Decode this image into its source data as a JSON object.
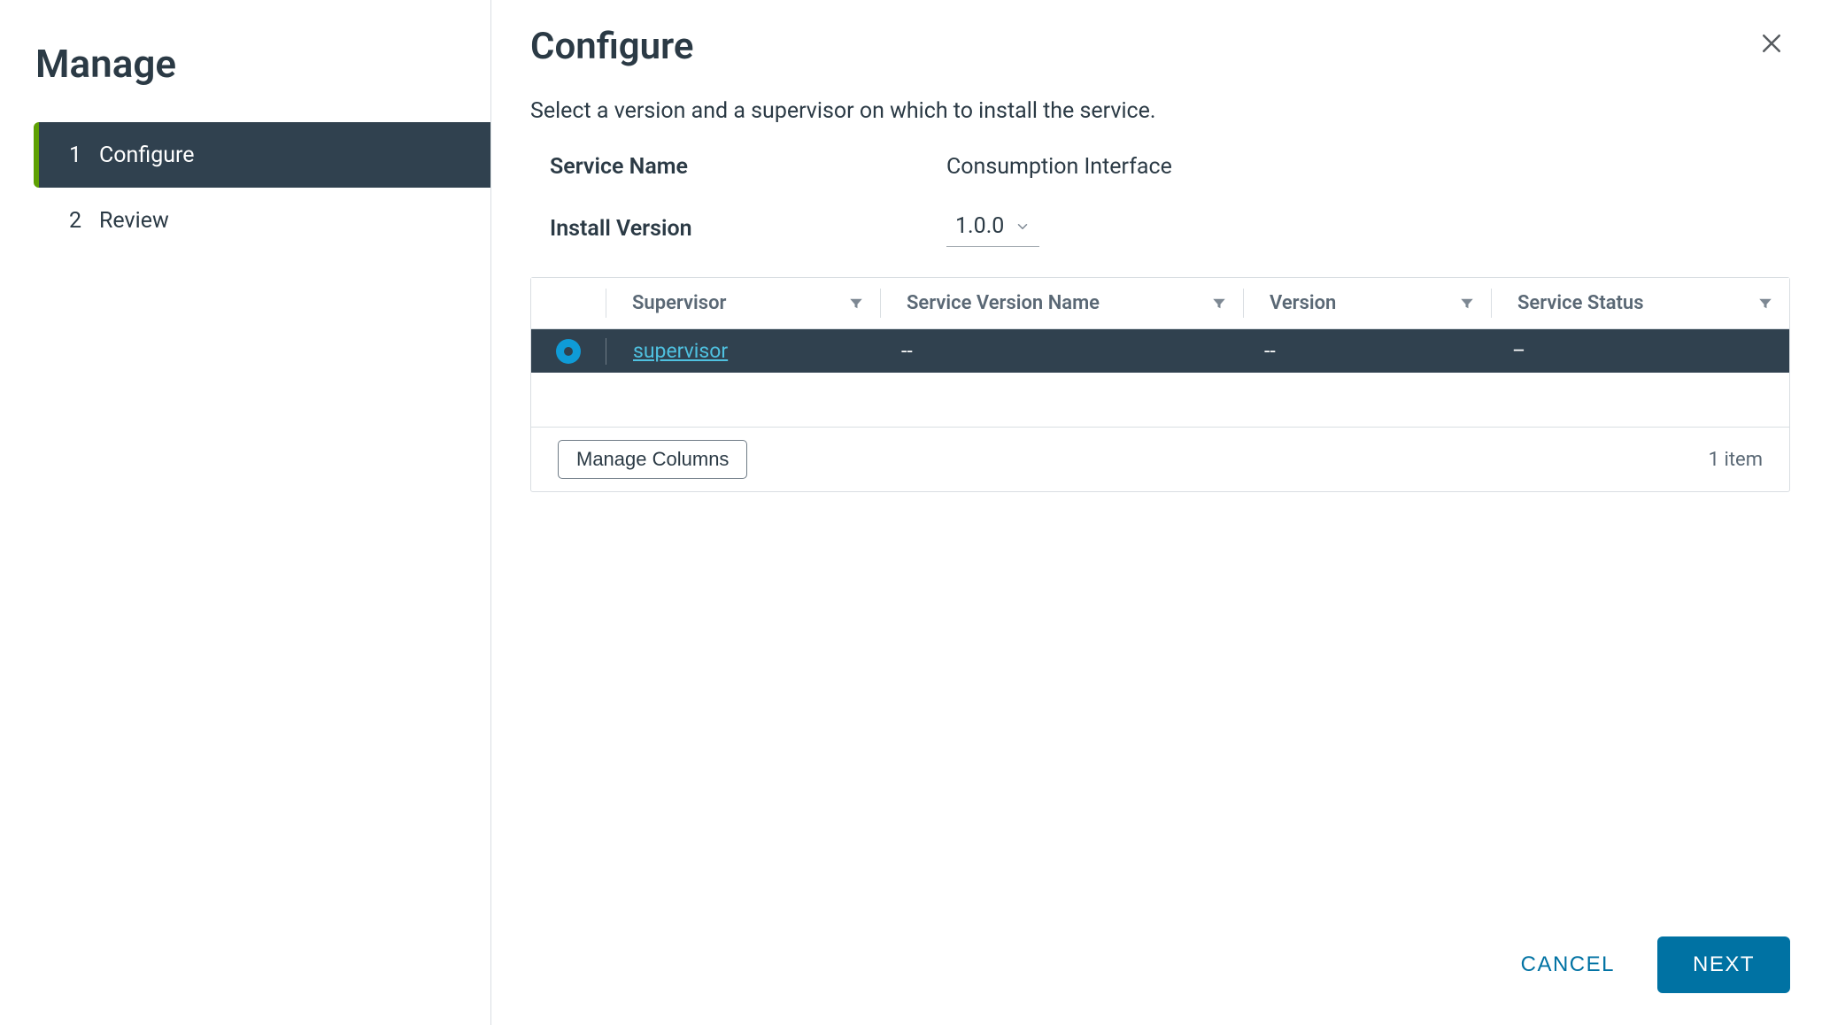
{
  "sidebar": {
    "title": "Manage",
    "steps": [
      {
        "number": "1",
        "label": "Configure",
        "active": true
      },
      {
        "number": "2",
        "label": "Review",
        "active": false
      }
    ]
  },
  "main": {
    "title": "Configure",
    "subtitle": "Select a version and a supervisor on which to install the service.",
    "service_name_label": "Service Name",
    "service_name_value": "Consumption Interface",
    "install_version_label": "Install Version",
    "install_version_value": "1.0.0"
  },
  "table": {
    "columns": {
      "supervisor": "Supervisor",
      "service_version_name": "Service Version Name",
      "version": "Version",
      "service_status": "Service Status"
    },
    "rows": [
      {
        "selected": true,
        "supervisor": "supervisor",
        "service_version_name": "--",
        "version": "--",
        "service_status": "–"
      }
    ],
    "manage_columns_label": "Manage Columns",
    "item_count": "1 item"
  },
  "footer": {
    "cancel": "CANCEL",
    "next": "NEXT"
  }
}
